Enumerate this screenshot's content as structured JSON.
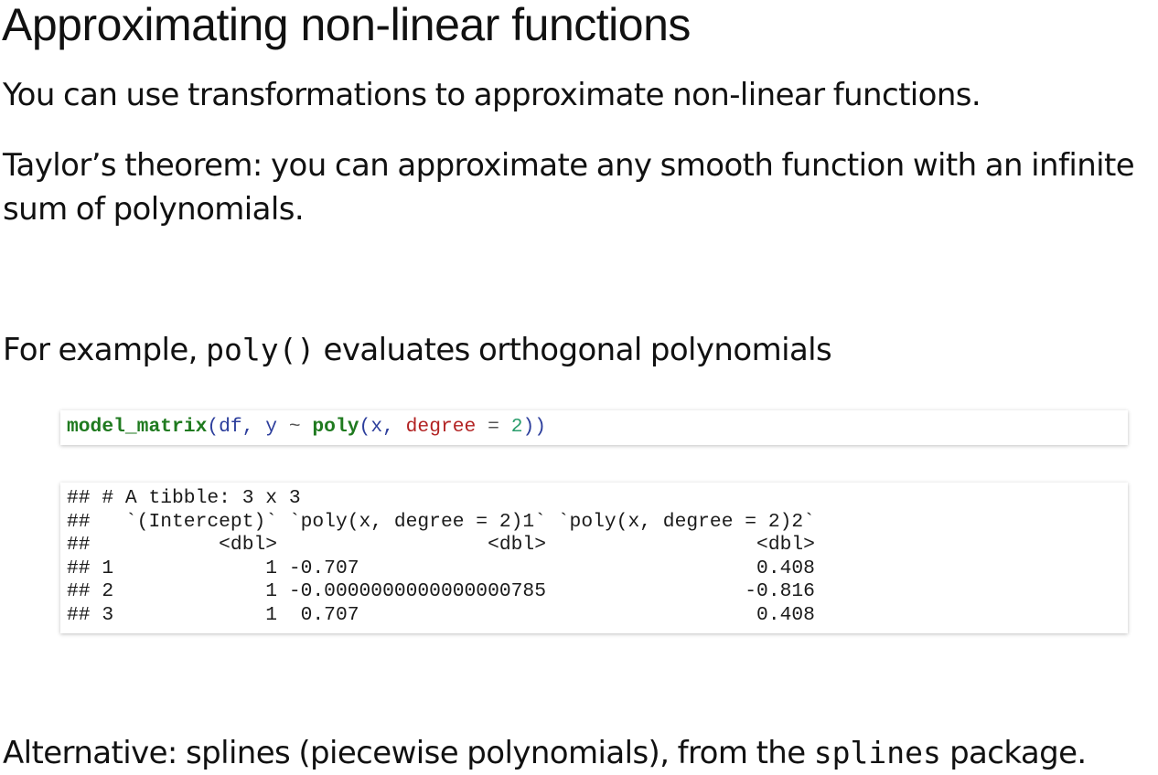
{
  "title": "Approximating non-linear functions",
  "paragraphs": {
    "p1": "You can use transformations to approximate non-linear functions.",
    "p2_line1": "Taylor’s theorem: you can approximate any smooth function with an infinite",
    "p2_line2": "sum of polynomials.",
    "p3_before": "For example, ",
    "p3_code": "poly()",
    "p3_after": " evaluates orthogonal polynomials",
    "p4_before": "Alternative: splines (piecewise polynomials), from the ",
    "p4_code": "splines",
    "p4_after": " package."
  },
  "code_input": {
    "fn": "model_matrix",
    "open": "(",
    "df": "df",
    "comma1": ", ",
    "y": "y",
    "tilde": " ~ ",
    "poly": "poly",
    "open2": "(",
    "x": "x",
    "comma2": ", ",
    "degree": "degree",
    "eq": " = ",
    "num": "2",
    "close": "))"
  },
  "code_output": {
    "lines": [
      "## # A tibble: 3 x 3",
      "##   `(Intercept)` `poly(x, degree = 2)1` `poly(x, degree = 2)2`",
      "##           <dbl>                  <dbl>                  <dbl>",
      "## 1             1 -0.707                                  0.408",
      "## 2             1 -0.0000000000000000785                 -0.816",
      "## 3             1  0.707                                  0.408"
    ]
  },
  "colors": {
    "function_name": "#1f7a1f",
    "identifier": "#2c3e9c",
    "argument_name": "#b22222",
    "number": "#2a9d6c"
  }
}
